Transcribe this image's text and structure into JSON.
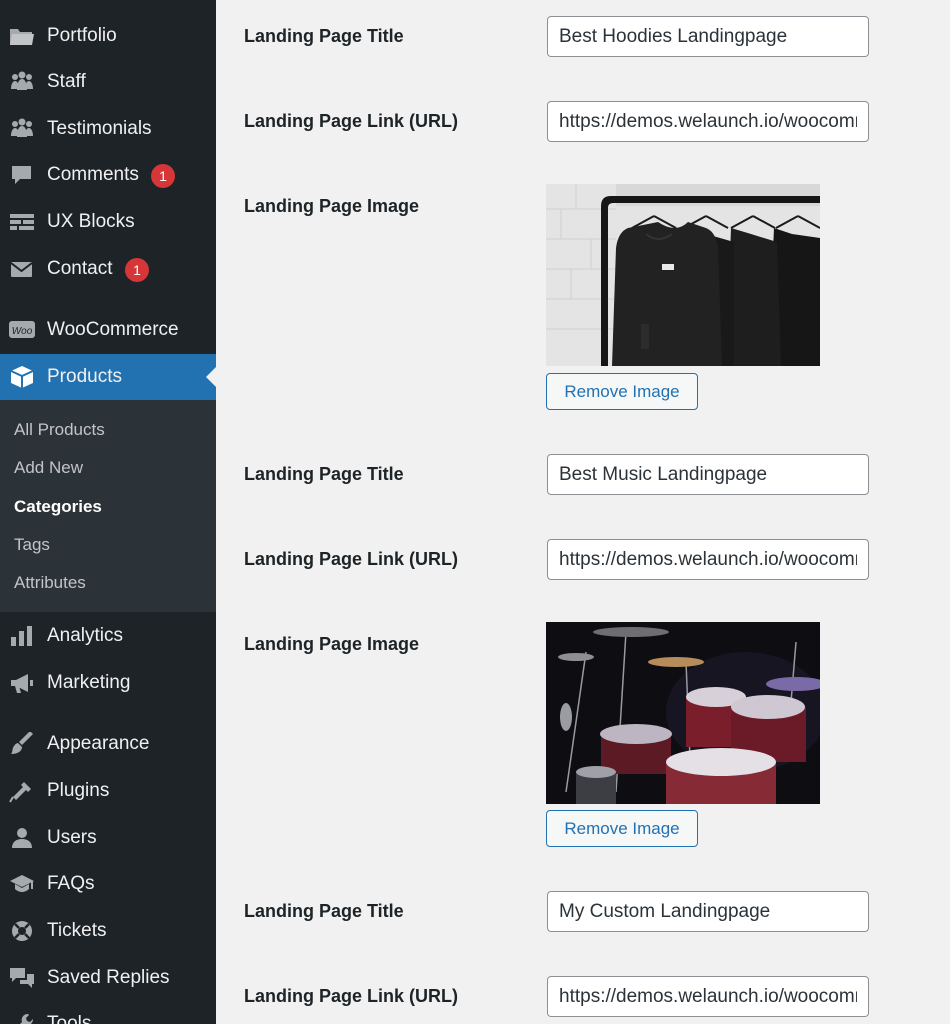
{
  "sidebar": {
    "items": [
      {
        "label": "Portfolio",
        "icon": "folder-icon"
      },
      {
        "label": "Staff",
        "icon": "people-icon"
      },
      {
        "label": "Testimonials",
        "icon": "people-icon"
      },
      {
        "label": "Comments",
        "icon": "comment-icon",
        "badge": "1"
      },
      {
        "label": "UX Blocks",
        "icon": "blocks-icon"
      },
      {
        "label": "Contact",
        "icon": "mail-icon",
        "badge": "1"
      },
      {
        "label": "WooCommerce",
        "icon": "woo-icon"
      },
      {
        "label": "Products",
        "icon": "box-icon"
      },
      {
        "label": "Analytics",
        "icon": "bar-chart-icon"
      },
      {
        "label": "Marketing",
        "icon": "megaphone-icon"
      },
      {
        "label": "Appearance",
        "icon": "brush-icon"
      },
      {
        "label": "Plugins",
        "icon": "plug-icon"
      },
      {
        "label": "Users",
        "icon": "user-icon"
      },
      {
        "label": "FAQs",
        "icon": "graduation-cap-icon"
      },
      {
        "label": "Tickets",
        "icon": "lifebuoy-icon"
      },
      {
        "label": "Saved Replies",
        "icon": "chat-bubbles-icon"
      },
      {
        "label": "Tools",
        "icon": "wrench-icon"
      }
    ],
    "submenu": [
      "All Products",
      "Add New",
      "Categories",
      "Tags",
      "Attributes"
    ],
    "current_submenu": "Categories"
  },
  "landing_pages": [
    {
      "title_label": "Landing Page Title",
      "title_value": "Best Hoodies Landingpage",
      "link_label": "Landing Page Link (URL)",
      "link_value": "https://demos.welaunch.io/woocommerce-landing-pages/hoodies",
      "image_label": "Landing Page Image",
      "image_alt": "hoodies",
      "remove_label": "Remove Image"
    },
    {
      "title_label": "Landing Page Title",
      "title_value": "Best Music Landingpage",
      "link_label": "Landing Page Link (URL)",
      "link_value": "https://demos.welaunch.io/woocommerce-landing-pages/music",
      "image_label": "Landing Page Image",
      "image_alt": "drums",
      "remove_label": "Remove Image"
    },
    {
      "title_label": "Landing Page Title",
      "title_value": "My Custom Landingpage",
      "link_label": "Landing Page Link (URL)",
      "link_value": "https://demos.welaunch.io/woocommerce-landing-pages/custom"
    }
  ],
  "colors": {
    "sidebar_bg": "#1d2327",
    "submenu_bg": "#2c3338",
    "active_bg": "#2271b1",
    "badge": "#d63638",
    "page_bg": "#f1f1f1"
  }
}
